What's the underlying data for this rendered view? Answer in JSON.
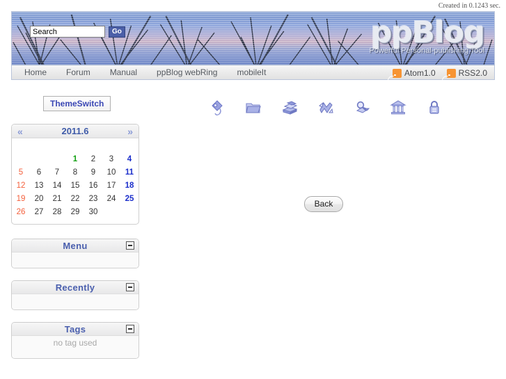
{
  "status": {
    "created_text": "Created in 0.1243 sec."
  },
  "header": {
    "search": {
      "value": "Search",
      "placeholder": "Search",
      "go_label": "Go"
    },
    "logo": {
      "title": "ppBlog",
      "tagline": "Powerful Personal-publishing Tool"
    },
    "nav": [
      {
        "label": "Home",
        "name": "nav-home"
      },
      {
        "label": "Forum",
        "name": "nav-forum"
      },
      {
        "label": "Manual",
        "name": "nav-manual"
      },
      {
        "label": "ppBlog webRing",
        "name": "nav-ppblog-webring"
      },
      {
        "label": "mobileIt",
        "name": "nav-mobileit"
      }
    ],
    "feeds": [
      {
        "label": "Atom1.0",
        "icon": "rss-icon"
      },
      {
        "label": "RSS2.0",
        "icon": "rss-icon"
      }
    ]
  },
  "toolbar": {
    "theme_switch_label": "ThemeSwitch",
    "icons": [
      {
        "name": "tag-icon",
        "title": "Tags"
      },
      {
        "name": "folder-icon",
        "title": "Categories"
      },
      {
        "name": "books-icon",
        "title": "Archives"
      },
      {
        "name": "shuffle-icon",
        "title": "Random"
      },
      {
        "name": "search-map-icon",
        "title": "Search"
      },
      {
        "name": "bank-icon",
        "title": "Archive Bank"
      },
      {
        "name": "lock-icon",
        "title": "Admin Login"
      }
    ]
  },
  "calendar": {
    "prev_label": "«",
    "next_label": "»",
    "title": "2011.6",
    "weeks": [
      [
        {
          "d": "",
          "t": "empty"
        },
        {
          "d": "",
          "t": "empty"
        },
        {
          "d": "",
          "t": "empty"
        },
        {
          "d": "1",
          "t": "today"
        },
        {
          "d": "2",
          "t": "day"
        },
        {
          "d": "3",
          "t": "day"
        },
        {
          "d": "4",
          "t": "sat"
        }
      ],
      [
        {
          "d": "5",
          "t": "sun"
        },
        {
          "d": "6",
          "t": "day"
        },
        {
          "d": "7",
          "t": "day"
        },
        {
          "d": "8",
          "t": "day"
        },
        {
          "d": "9",
          "t": "day"
        },
        {
          "d": "10",
          "t": "day"
        },
        {
          "d": "11",
          "t": "sat"
        }
      ],
      [
        {
          "d": "12",
          "t": "sun"
        },
        {
          "d": "13",
          "t": "day"
        },
        {
          "d": "14",
          "t": "day"
        },
        {
          "d": "15",
          "t": "day"
        },
        {
          "d": "16",
          "t": "day"
        },
        {
          "d": "17",
          "t": "day"
        },
        {
          "d": "18",
          "t": "sat"
        }
      ],
      [
        {
          "d": "19",
          "t": "sun"
        },
        {
          "d": "20",
          "t": "day"
        },
        {
          "d": "21",
          "t": "day"
        },
        {
          "d": "22",
          "t": "day"
        },
        {
          "d": "23",
          "t": "day"
        },
        {
          "d": "24",
          "t": "day"
        },
        {
          "d": "25",
          "t": "sat"
        }
      ],
      [
        {
          "d": "26",
          "t": "sun"
        },
        {
          "d": "27",
          "t": "day"
        },
        {
          "d": "28",
          "t": "day"
        },
        {
          "d": "29",
          "t": "day"
        },
        {
          "d": "30",
          "t": "day"
        },
        {
          "d": "",
          "t": "empty"
        },
        {
          "d": "",
          "t": "empty"
        }
      ]
    ]
  },
  "sidebar": {
    "panels": [
      {
        "title": "Menu",
        "body": "",
        "collapse": "−",
        "name": "panel-menu"
      },
      {
        "title": "Recently",
        "body": "",
        "collapse": "−",
        "name": "panel-recently"
      },
      {
        "title": "Tags",
        "body": "no tag used",
        "collapse": "−",
        "name": "panel-tags"
      }
    ]
  },
  "main": {
    "back_label": "Back"
  },
  "colors": {
    "accent": "#4a5fae",
    "link": "#3f5ba9",
    "sunday": "#f4603c",
    "saturday": "#1b2ecb",
    "today": "#11a011",
    "rss_orange": "#f79433",
    "icon_violet": "#8b92d8"
  }
}
